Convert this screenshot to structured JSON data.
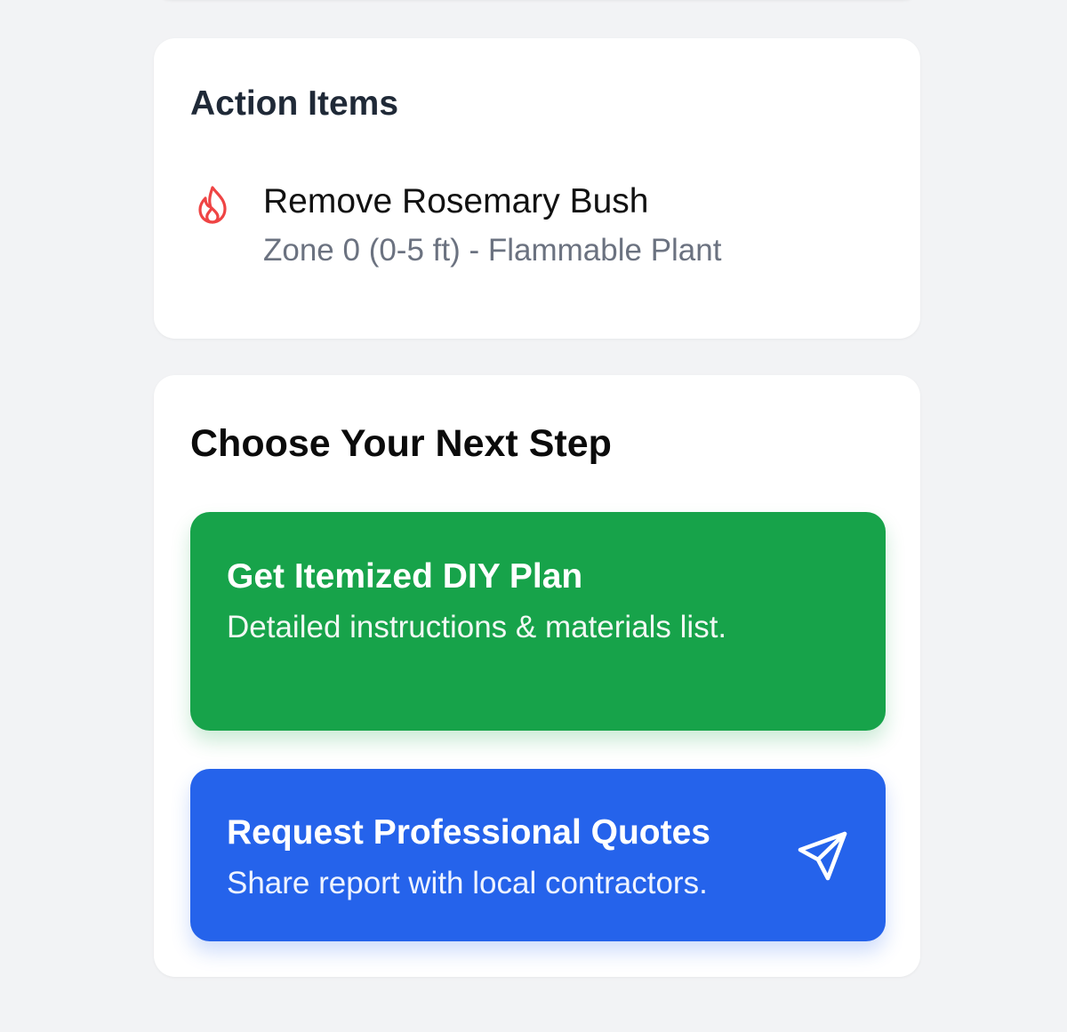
{
  "action_items": {
    "title": "Action Items",
    "items": [
      {
        "title": "Remove Rosemary Bush",
        "subtitle": "Zone 0 (0-5 ft) - Flammable Plant",
        "icon": "flame-icon",
        "icon_color": "#ef4444"
      }
    ]
  },
  "next_step": {
    "title": "Choose Your Next Step",
    "diy": {
      "title": "Get Itemized DIY Plan",
      "subtitle": "Detailed instructions & materials list.",
      "color": "#17a34a"
    },
    "pro": {
      "title": "Request Professional Quotes",
      "subtitle": "Share report with local contractors.",
      "icon": "send-icon",
      "color": "#2563eb"
    }
  }
}
